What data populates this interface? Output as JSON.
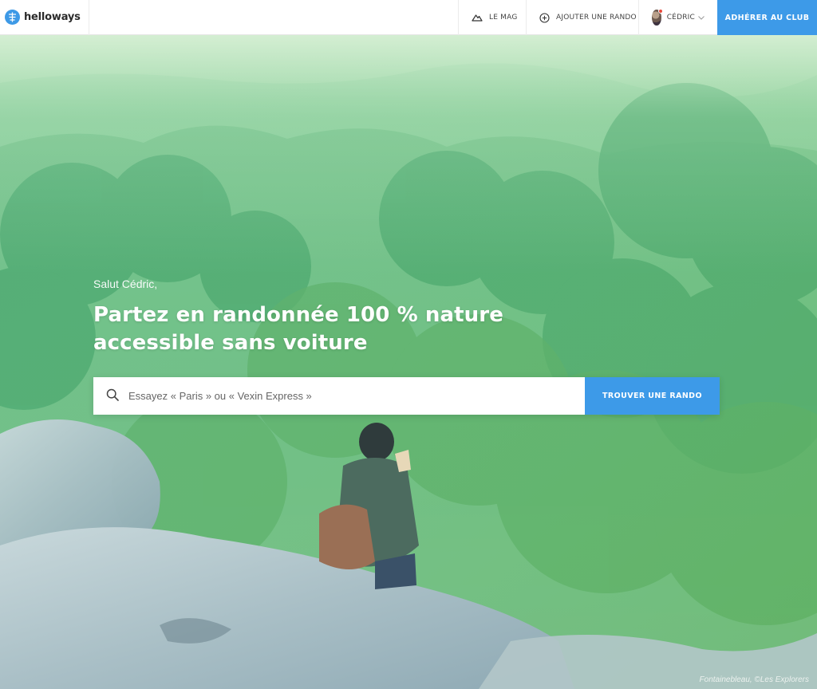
{
  "header": {
    "logo_text": "helloways",
    "nav": {
      "mag_label": "LE MAG",
      "add_label": "AJOUTER UNE RANDO",
      "user_label": "CÉDRIC",
      "cta_label": "ADHÉRER AU CLUB"
    }
  },
  "hero": {
    "greeting": "Salut Cédric,",
    "title": "Partez en randonnée 100 % nature accessible sans voiture",
    "search": {
      "placeholder": "Essayez « Paris » ou « Vexin Express »",
      "button_label": "TROUVER UNE RANDO"
    },
    "photo_credit": "Fontainebleau, ©Les Explorers"
  },
  "colors": {
    "accent": "#3d9ae8",
    "header_bg": "#ffffff",
    "hero_green": "#5cbc83"
  },
  "icons": {
    "logo": "helloways-logo-icon",
    "mag": "mountain-icon",
    "add": "plus-circle-icon",
    "user_menu": "chevron-down-icon",
    "search": "search-icon"
  }
}
